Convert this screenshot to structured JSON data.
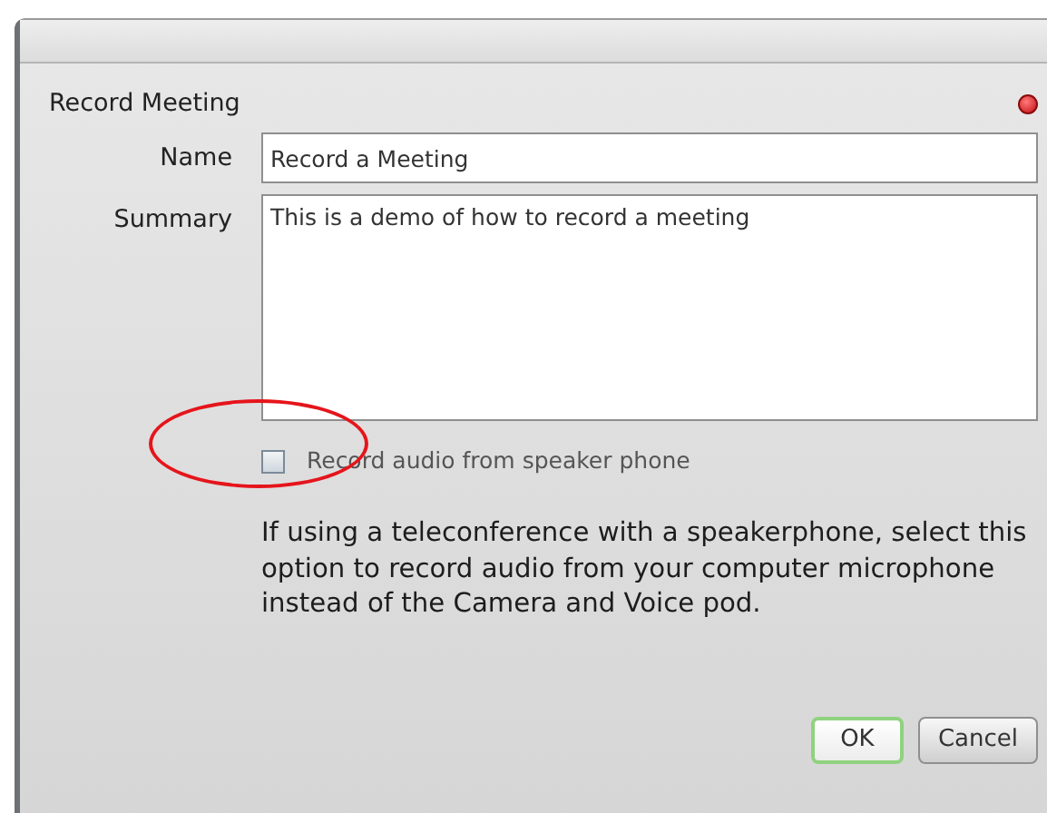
{
  "dialog": {
    "title": "Record Meeting"
  },
  "fields": [
    {
      "label": "Name",
      "kind": "line",
      "value": "Record a Meeting"
    },
    {
      "label": "Summary",
      "kind": "area",
      "value": "This is a demo of how to record a meeting"
    }
  ],
  "option": {
    "label": "Record audio from speaker phone",
    "checked": false
  },
  "help_text": "If using a teleconference with a speakerphone, select this option to record audio from your computer microphone instead of the Camera and Voice pod.",
  "buttons": [
    {
      "label": "OK",
      "kind": "default"
    },
    {
      "label": "Cancel",
      "kind": "plain"
    }
  ],
  "annotation": {
    "kind": "ellipse"
  }
}
